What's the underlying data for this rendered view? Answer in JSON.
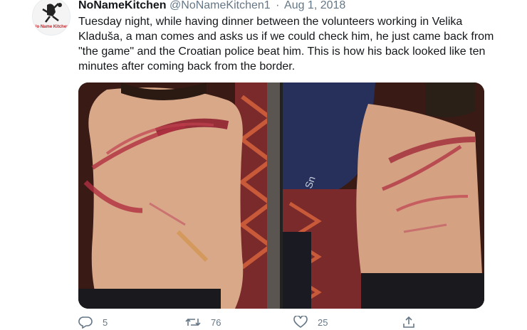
{
  "tweet": {
    "author_name": "NoNameKitchen",
    "author_handle": "@NoNameKitchen1",
    "separator": "·",
    "date": "Aug 1, 2018",
    "text": "Tuesday night, while having dinner between the volunteers working in Velika Kladuša, a man comes and asks us if we could check him, he just came back from \"the game\" and the Croatian police beat him. This is how his back looked like ten minutes after coming back from the border.",
    "avatar_text": "No Name Kitchen"
  },
  "actions": {
    "reply_count": "5",
    "retweet_count": "76",
    "like_count": "25"
  },
  "icons": {
    "reply": "reply-icon",
    "retweet": "retweet-icon",
    "like": "heart-icon",
    "share": "share-icon"
  },
  "colors": {
    "text": "#14171a",
    "secondary": "#657786",
    "brand_red": "#c0272d"
  }
}
